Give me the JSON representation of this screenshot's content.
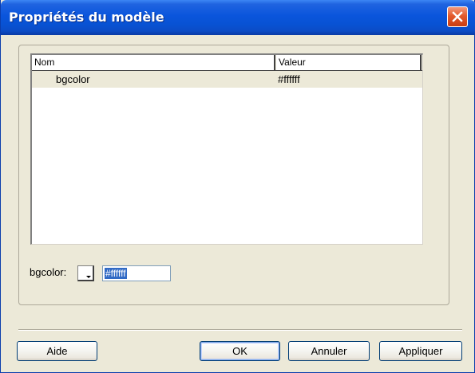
{
  "window": {
    "title": "Propriétés du modèle"
  },
  "table": {
    "columns": [
      "Nom",
      "Valeur"
    ],
    "rows": [
      {
        "name": "bgcolor",
        "value": "#ffffff"
      }
    ]
  },
  "editor": {
    "label": "bgcolor:",
    "value": "#ffffff"
  },
  "buttons": {
    "help": "Aide",
    "ok": "OK",
    "cancel": "Annuler",
    "apply": "Appliquer"
  },
  "icons": {
    "close": "close-icon",
    "dropdown": "chevron-down-icon"
  },
  "colors": {
    "titlebar": "#0a55dc",
    "close_button": "#e45a2c",
    "selection": "#316ac5",
    "dialog_background": "#ece9d8"
  }
}
